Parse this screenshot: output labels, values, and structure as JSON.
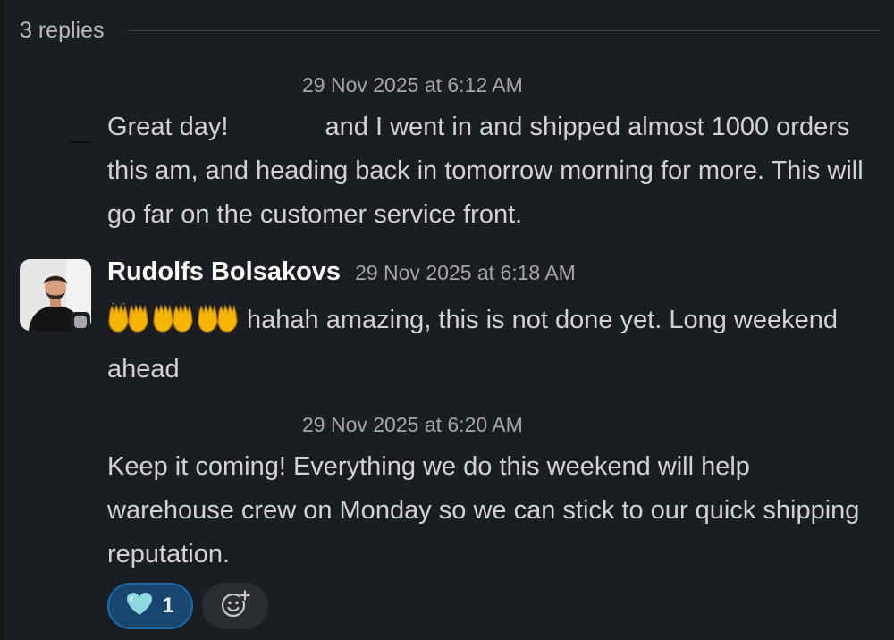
{
  "thread": {
    "replies_label": "3 replies"
  },
  "messages": [
    {
      "timestamp": "29 Nov 2025 at 6:12 AM",
      "text_part1": "Great day!",
      "text_part2": "and I went in and shipped almost 1000 orders this am, and heading back in tomorrow morning for more. This will go far on the customer service front."
    },
    {
      "sender": "Rudolfs Bolsakovs",
      "timestamp": "29 Nov 2025 at 6:18 AM",
      "emoji": "raised-hands x3",
      "text": "hahah amazing, this is not done yet. Long weekend ahead"
    },
    {
      "timestamp": "29 Nov 2025 at 6:20 AM",
      "text": "Keep it coming! Everything we do this weekend will help warehouse crew on Monday so we can stick to our quick shipping reputation."
    }
  ],
  "reactions": [
    {
      "emoji": "light-blue-heart",
      "count": "1"
    }
  ],
  "icons": {
    "add_reaction": "add-reaction-icon",
    "reaction": "light-blue-heart-icon",
    "emoji": "raised-hands-icon"
  },
  "colors": {
    "background": "#1a1d21",
    "text": "#d1d2d3",
    "muted": "#a5a6a9",
    "reaction_bg": "#17466e",
    "reaction_border": "#1d6cb2",
    "heart": "#8fd8e0",
    "hands": "#f4b400"
  }
}
